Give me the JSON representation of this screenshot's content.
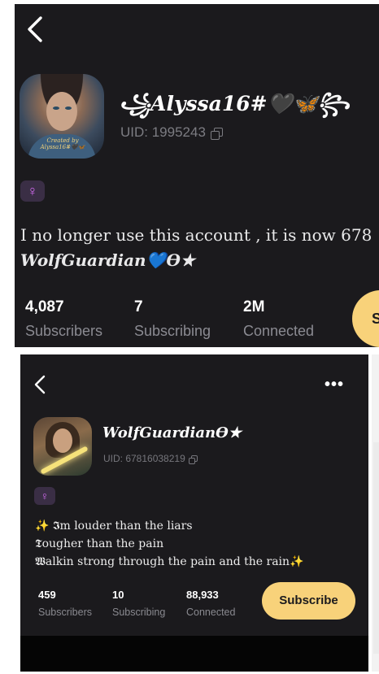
{
  "profile": {
    "username": "꧁Alyssa16#🖤🦋꧂",
    "uid_label": "UID: 1995243",
    "avatar_caption": "Created by Alyssa16#🖤🦋",
    "gender_symbol": "♀",
    "bio_line1": "I no longer use this account , it is now 678",
    "bio_line2": "WolfGuardian💙Ѳ★",
    "stats": [
      {
        "value": "4,087",
        "label": "Subscribers"
      },
      {
        "value": "7",
        "label": "Subscribing"
      },
      {
        "value": "2M",
        "label": "Connected"
      }
    ],
    "subscribe_label": "S"
  },
  "inset_profile": {
    "username": "WolfGuardianѲ★",
    "uid_label": "UID: 67816038219",
    "gender_symbol": "♀",
    "bio_lines": [
      "✨ 𝕴m louder than the liars",
      "𝕿ougher than the pain",
      "𝖂alkin strong through the pain and the rain✨"
    ],
    "stats": [
      {
        "value": "459",
        "label": "Subscribers"
      },
      {
        "value": "10",
        "label": "Subscribing"
      },
      {
        "value": "88,933",
        "label": "Connected"
      }
    ],
    "subscribe_label": "Subscribe",
    "more_label": "•••"
  },
  "colors": {
    "background": "#1b1a1d",
    "accent_yellow": "#f8d27a",
    "gender_purple": "#d26bf0"
  },
  "icons": [
    "back-chevron-icon",
    "copy-icon",
    "female-icon",
    "more-icon"
  ]
}
